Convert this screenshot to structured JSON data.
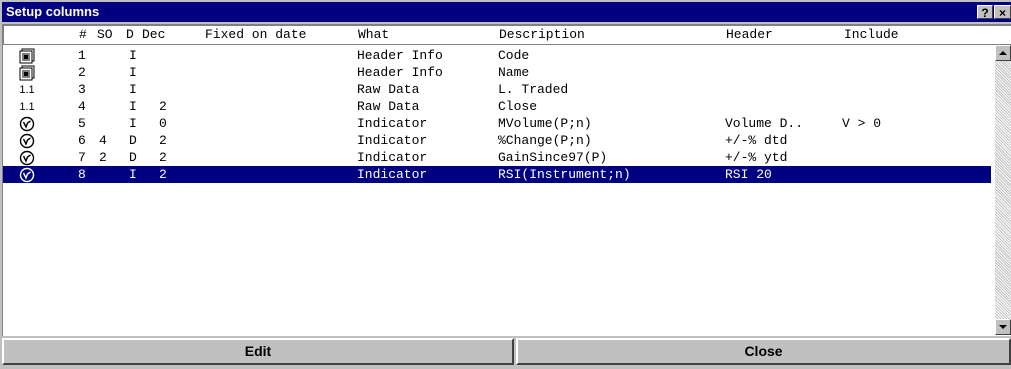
{
  "window": {
    "title": "Setup columns",
    "help_label": "?",
    "close_label": "×"
  },
  "columns": [
    "#",
    "SO",
    "D",
    "Dec",
    "Fixed on date",
    "What",
    "Description",
    "Header",
    "Include"
  ],
  "rows": [
    {
      "icon": "header-info-icon",
      "icon_text": "",
      "num": "1",
      "so": "",
      "d": "I",
      "dec": "",
      "fixed": "",
      "what": "Header Info",
      "description": "Code",
      "header": "",
      "include": ""
    },
    {
      "icon": "header-info-icon",
      "icon_text": "",
      "num": "2",
      "so": "",
      "d": "I",
      "dec": "",
      "fixed": "",
      "what": "Header Info",
      "description": "Name",
      "header": "",
      "include": ""
    },
    {
      "icon": "raw-data-icon",
      "icon_text": "1.1",
      "num": "3",
      "so": "",
      "d": "I",
      "dec": "",
      "fixed": "",
      "what": "Raw Data",
      "description": "L. Traded",
      "header": "",
      "include": ""
    },
    {
      "icon": "raw-data-icon",
      "icon_text": "1.1",
      "num": "4",
      "so": "",
      "d": "I",
      "dec": "2",
      "fixed": "",
      "what": "Raw Data",
      "description": "Close",
      "header": "",
      "include": ""
    },
    {
      "icon": "indicator-icon",
      "icon_text": "",
      "num": "5",
      "so": "",
      "d": "I",
      "dec": "0",
      "fixed": "",
      "what": "Indicator",
      "description": "MVolume(P;n)",
      "header": "Volume D..",
      "include": "V > 0"
    },
    {
      "icon": "indicator-icon",
      "icon_text": "",
      "num": "6",
      "so": "4",
      "d": "D",
      "dec": "2",
      "fixed": "",
      "what": "Indicator",
      "description": "%Change(P;n)",
      "header": "+/-% dtd",
      "include": ""
    },
    {
      "icon": "indicator-icon",
      "icon_text": "",
      "num": "7",
      "so": "2",
      "d": "D",
      "dec": "2",
      "fixed": "",
      "what": "Indicator",
      "description": "GainSince97(P)",
      "header": "+/-% ytd",
      "include": ""
    },
    {
      "icon": "indicator-icon",
      "icon_text": "",
      "num": "8",
      "so": "",
      "d": "I",
      "dec": "2",
      "fixed": "",
      "what": "Indicator",
      "description": "RSI(Instrument;n)",
      "header": "RSI 20",
      "include": "",
      "selected": true
    }
  ],
  "buttons": {
    "edit": "Edit",
    "close": "Close"
  }
}
